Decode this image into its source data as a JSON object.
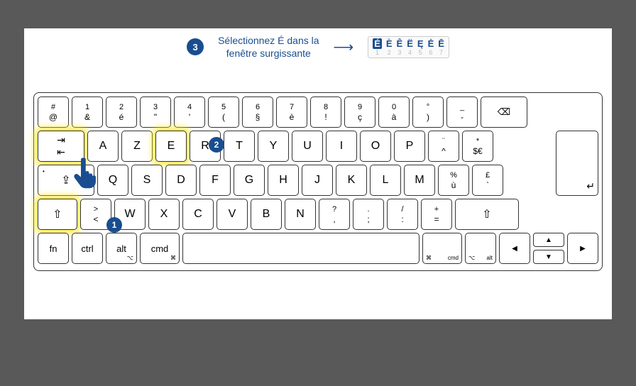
{
  "header": {
    "step3_num": "3",
    "instruction_line1": "Sélectionnez É dans la",
    "instruction_line2": "fenêtre surgissante"
  },
  "popup": [
    {
      "char": "É",
      "num": "1"
    },
    {
      "char": "È",
      "num": "2"
    },
    {
      "char": "Ê",
      "num": "3"
    },
    {
      "char": "Ë",
      "num": "4"
    },
    {
      "char": "Ę",
      "num": "5"
    },
    {
      "char": "Ė",
      "num": "6"
    },
    {
      "char": "Ē",
      "num": "7"
    }
  ],
  "markers": {
    "step1": "1",
    "step2": "2"
  },
  "rows": {
    "r0": [
      {
        "t": "#",
        "b": "@"
      },
      {
        "t": "1",
        "b": "&"
      },
      {
        "t": "2",
        "b": "é"
      },
      {
        "t": "3",
        "b": "\""
      },
      {
        "t": "4",
        "b": "'"
      },
      {
        "t": "5",
        "b": "("
      },
      {
        "t": "6",
        "b": "§"
      },
      {
        "t": "7",
        "b": "è"
      },
      {
        "t": "8",
        "b": "!"
      },
      {
        "t": "9",
        "b": "ç"
      },
      {
        "t": "0",
        "b": "à"
      },
      {
        "t": "°",
        "b": ")"
      },
      {
        "t": "_",
        "b": "-"
      }
    ],
    "r1": [
      "A",
      "Z",
      "E",
      "R",
      "T",
      "Y",
      "U",
      "I",
      "O",
      "P"
    ],
    "r1_extra": [
      {
        "t": "¨",
        "b": "^"
      },
      {
        "t": "*",
        "b": "$€"
      }
    ],
    "r2": [
      "Q",
      "S",
      "D",
      "F",
      "G",
      "H",
      "J",
      "K",
      "L",
      "M"
    ],
    "r2_extra": [
      {
        "t": "%",
        "b": "ù"
      },
      {
        "t": "£",
        "b": "`"
      }
    ],
    "r3_first": {
      "t": ">",
      "b": "<"
    },
    "r3": [
      "W",
      "X",
      "C",
      "V",
      "B",
      "N"
    ],
    "r3_extra": [
      {
        "t": "?",
        "b": ","
      },
      {
        "t": ".",
        "b": ";"
      },
      {
        "t": "/",
        "b": ":"
      },
      {
        "t": "+",
        "b": "="
      }
    ],
    "r4": {
      "fn": "fn",
      "ctrl": "ctrl",
      "alt": "alt",
      "cmd": "cmd"
    }
  }
}
